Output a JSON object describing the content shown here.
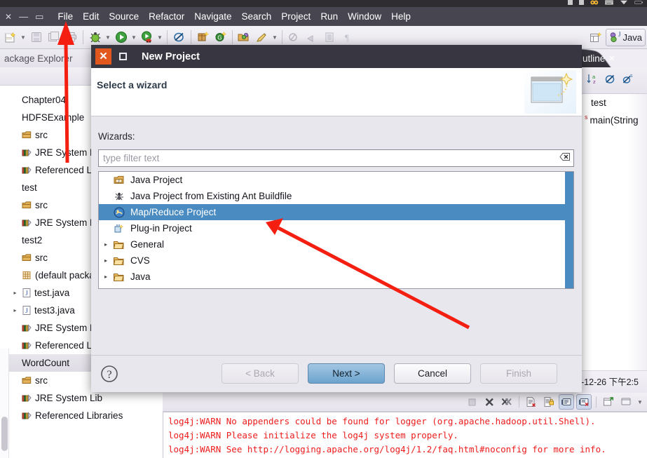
{
  "menubar": {
    "window_controls": [
      "✕",
      "—",
      "▭"
    ],
    "items": [
      "File",
      "Edit",
      "Source",
      "Refactor",
      "Navigate",
      "Search",
      "Project",
      "Run",
      "Window",
      "Help"
    ]
  },
  "toolbar": {
    "icons": [
      "new-wizard-icon",
      "dropdown-arrow",
      "save-icon",
      "save-all-icon",
      "print-icon",
      "debug-icon",
      "dropdown-arrow",
      "run-icon",
      "dropdown-arrow",
      "run-coverage-icon",
      "dropdown-arrow",
      "external-tools-icon",
      "new-java-package-icon",
      "new-java-class-icon",
      "open-type-icon",
      "search-icon",
      "dropdown-arrow",
      "next-annotation-icon",
      "previous-annotation-icon",
      "last-edit-icon",
      "pilcrow-icon"
    ],
    "perspective_new_label": "new-perspective-icon",
    "perspective_java_label": "Java"
  },
  "package_explorer": {
    "tab_title": "ackage Explorer",
    "items": [
      {
        "label": "Chapter04",
        "icon": "",
        "twisty": "",
        "selected": false
      },
      {
        "label": "HDFSExample",
        "icon": "",
        "twisty": "",
        "selected": false
      },
      {
        "label": "src",
        "icon": "package-icon",
        "twisty": "",
        "selected": false
      },
      {
        "label": "JRE System Lib",
        "icon": "library-icon",
        "twisty": "",
        "selected": false
      },
      {
        "label": "Referenced Lib",
        "icon": "library-icon",
        "twisty": "",
        "selected": false
      },
      {
        "label": "test",
        "icon": "",
        "twisty": "",
        "selected": false
      },
      {
        "label": "src",
        "icon": "package-icon",
        "twisty": "",
        "selected": false
      },
      {
        "label": "JRE System Lib",
        "icon": "library-icon",
        "twisty": "",
        "selected": false
      },
      {
        "label": "test2",
        "icon": "",
        "twisty": "",
        "selected": false
      },
      {
        "label": "src",
        "icon": "package-icon",
        "twisty": "",
        "selected": false
      },
      {
        "label": "(default packa",
        "icon": "package-grid-icon",
        "twisty": "",
        "selected": false
      },
      {
        "label": "test.java",
        "icon": "java-file-icon",
        "twisty": "▸",
        "selected": false
      },
      {
        "label": "test3.java",
        "icon": "java-file-icon",
        "twisty": "▸",
        "selected": false
      },
      {
        "label": "JRE System Lib",
        "icon": "library-icon",
        "twisty": "",
        "selected": false
      },
      {
        "label": "Referenced Lib",
        "icon": "library-icon",
        "twisty": "",
        "selected": false
      },
      {
        "label": "WordCount",
        "icon": "",
        "twisty": "",
        "selected": true
      },
      {
        "label": "src",
        "icon": "package-icon",
        "twisty": "",
        "selected": false
      },
      {
        "label": "JRE System Lib",
        "icon": "library-icon",
        "twisty": "",
        "selected": false
      },
      {
        "label": "Referenced Libraries",
        "icon": "library-icon",
        "twisty": "",
        "selected": false
      }
    ]
  },
  "outline": {
    "tab_title": "utline",
    "tab_close": "✕",
    "tool_icons": [
      "sort-icon",
      "hide-fields-icon",
      "hide-static-icon"
    ],
    "items": [
      {
        "label": "test",
        "badge": ""
      },
      {
        "label": "main(String",
        "badge": "s"
      }
    ]
  },
  "console": {
    "toolbar_icons": [
      "terminate-icon",
      "remove-launch-icon",
      "remove-all-icon",
      "clear-console-icon",
      "scroll-lock-icon",
      "show-console-icon",
      "display-console-icon",
      "open-console-icon",
      "pin-console-icon",
      "dropdown-arrow"
    ],
    "lines": [
      "log4j:WARN No appenders could be found for logger (org.apache.hadoop.util.Shell).",
      "log4j:WARN Please initialize the log4j system properly.",
      "log4j:WARN See http://logging.apache.org/log4j/1.2/faq.html#noconfig for more info."
    ],
    "timestamp": "-12-26 下午2:5"
  },
  "dialog": {
    "title": "New Project",
    "close_glyph": "✕",
    "maximize_name": "maximize-icon",
    "header_title": "Select a wizard",
    "header_icon": "new-project-wizard-icon",
    "wizards_label": "Wizards:",
    "filter_placeholder": "type filter text",
    "filter_value": "",
    "filter_clear_icon": "clear-filter-icon",
    "list": [
      {
        "label": "Java Project",
        "icon": "java-project-icon",
        "twisty": "",
        "selected": false
      },
      {
        "label": "Java Project from Existing Ant Buildfile",
        "icon": "ant-icon",
        "twisty": "",
        "selected": false
      },
      {
        "label": "Map/Reduce Project",
        "icon": "mapreduce-icon",
        "twisty": "",
        "selected": true
      },
      {
        "label": "Plug-in Project",
        "icon": "plugin-icon",
        "twisty": "",
        "selected": false
      },
      {
        "label": "General",
        "icon": "folder-icon",
        "twisty": "▸",
        "selected": false
      },
      {
        "label": "CVS",
        "icon": "folder-icon",
        "twisty": "▸",
        "selected": false
      },
      {
        "label": "Java",
        "icon": "folder-icon",
        "twisty": "▸",
        "selected": false
      }
    ],
    "help_icon": "help-icon",
    "buttons": {
      "back": "< Back",
      "next": "Next >",
      "cancel": "Cancel",
      "finish": "Finish"
    }
  },
  "annotations": {
    "arrow_color": "#f41f11",
    "arrow1_target": "File menu",
    "arrow2_target": "Map/Reduce Project"
  }
}
